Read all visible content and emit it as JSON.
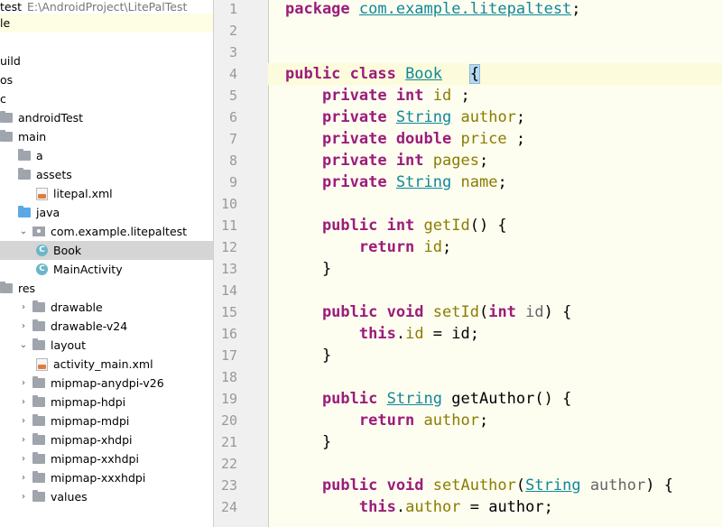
{
  "project_tree": {
    "root_label_partial": "test",
    "root_path": "E:\\AndroidProject\\LitePalTest",
    "items": [
      {
        "label": "le",
        "depth": 0,
        "chevron": "",
        "icon": "none",
        "state": "hl"
      },
      {
        "label": "",
        "depth": 0,
        "chevron": "",
        "icon": "none",
        "state": ""
      },
      {
        "label": "uild",
        "depth": 0,
        "chevron": "",
        "icon": "none",
        "state": ""
      },
      {
        "label": "os",
        "depth": 0,
        "chevron": "",
        "icon": "none",
        "state": ""
      },
      {
        "label": "c",
        "depth": 0,
        "chevron": "",
        "icon": "none",
        "state": ""
      },
      {
        "label": "androidTest",
        "depth": 0,
        "chevron": "",
        "icon": "folder",
        "state": ""
      },
      {
        "label": "main",
        "depth": 0,
        "chevron": "",
        "icon": "folder",
        "state": ""
      },
      {
        "label": "a",
        "depth": 1,
        "chevron": "",
        "icon": "folder",
        "state": ""
      },
      {
        "label": "assets",
        "depth": 1,
        "chevron": "",
        "icon": "folder",
        "state": ""
      },
      {
        "label": "litepal.xml",
        "depth": 2,
        "chevron": "",
        "icon": "xml",
        "state": ""
      },
      {
        "label": "java",
        "depth": 1,
        "chevron": "",
        "icon": "folder-blue",
        "state": ""
      },
      {
        "label": "com.example.litepaltest",
        "depth": 1,
        "chevron": "⌄",
        "icon": "package",
        "state": ""
      },
      {
        "label": "Book",
        "depth": 2,
        "chevron": "",
        "icon": "class",
        "state": "selected"
      },
      {
        "label": "MainActivity",
        "depth": 2,
        "chevron": "",
        "icon": "class",
        "state": ""
      },
      {
        "label": "res",
        "depth": 0,
        "chevron": "",
        "icon": "folder",
        "state": ""
      },
      {
        "label": "drawable",
        "depth": 1,
        "chevron": "›",
        "icon": "folder",
        "state": ""
      },
      {
        "label": "drawable-v24",
        "depth": 1,
        "chevron": "›",
        "icon": "folder",
        "state": ""
      },
      {
        "label": "layout",
        "depth": 1,
        "chevron": "⌄",
        "icon": "folder",
        "state": ""
      },
      {
        "label": "activity_main.xml",
        "depth": 2,
        "chevron": "",
        "icon": "xml",
        "state": ""
      },
      {
        "label": "mipmap-anydpi-v26",
        "depth": 1,
        "chevron": "›",
        "icon": "folder",
        "state": ""
      },
      {
        "label": "mipmap-hdpi",
        "depth": 1,
        "chevron": "›",
        "icon": "folder",
        "state": ""
      },
      {
        "label": "mipmap-mdpi",
        "depth": 1,
        "chevron": "›",
        "icon": "folder",
        "state": ""
      },
      {
        "label": "mipmap-xhdpi",
        "depth": 1,
        "chevron": "›",
        "icon": "folder",
        "state": ""
      },
      {
        "label": "mipmap-xxhdpi",
        "depth": 1,
        "chevron": "›",
        "icon": "folder",
        "state": ""
      },
      {
        "label": "mipmap-xxxhdpi",
        "depth": 1,
        "chevron": "›",
        "icon": "folder",
        "state": ""
      },
      {
        "label": "values",
        "depth": 1,
        "chevron": "›",
        "icon": "folder",
        "state": ""
      }
    ]
  },
  "editor": {
    "colors": {
      "keyword": "#9b1c7b",
      "type": "#10889a",
      "field": "#8a7d00",
      "param": "#666666"
    },
    "lines": [
      {
        "n": "1",
        "tokens": [
          {
            "t": "package ",
            "c": "kw"
          },
          {
            "t": "com.example.litepaltest",
            "c": "ref"
          },
          {
            "t": ";",
            "c": ""
          }
        ],
        "fold": false
      },
      {
        "n": "2",
        "tokens": [],
        "fold": false
      },
      {
        "n": "3",
        "tokens": [],
        "fold": false
      },
      {
        "n": "4",
        "tokens": [
          {
            "t": "public class ",
            "c": "kw"
          },
          {
            "t": "Book",
            "c": "ty"
          },
          {
            "t": "   ",
            "c": ""
          },
          {
            "t": "{",
            "c": "brace-hl"
          }
        ],
        "fold": false
      },
      {
        "n": "5",
        "tokens": [
          {
            "t": "    private int ",
            "c": "kw"
          },
          {
            "t": "id",
            "c": "fld"
          },
          {
            "t": " ;",
            "c": ""
          }
        ],
        "fold": false
      },
      {
        "n": "6",
        "tokens": [
          {
            "t": "    private ",
            "c": "kw"
          },
          {
            "t": "String",
            "c": "ty"
          },
          {
            "t": " ",
            "c": ""
          },
          {
            "t": "author",
            "c": "fld"
          },
          {
            "t": ";",
            "c": ""
          }
        ],
        "fold": false
      },
      {
        "n": "7",
        "tokens": [
          {
            "t": "    private double ",
            "c": "kw"
          },
          {
            "t": "price",
            "c": "fld"
          },
          {
            "t": " ;",
            "c": ""
          }
        ],
        "fold": false
      },
      {
        "n": "8",
        "tokens": [
          {
            "t": "    private int ",
            "c": "kw"
          },
          {
            "t": "pages",
            "c": "fld"
          },
          {
            "t": ";",
            "c": ""
          }
        ],
        "fold": false
      },
      {
        "n": "9",
        "tokens": [
          {
            "t": "    private ",
            "c": "kw"
          },
          {
            "t": "String",
            "c": "ty"
          },
          {
            "t": " ",
            "c": ""
          },
          {
            "t": "name",
            "c": "fld"
          },
          {
            "t": ";",
            "c": ""
          }
        ],
        "fold": false
      },
      {
        "n": "10",
        "tokens": [],
        "fold": false
      },
      {
        "n": "11",
        "tokens": [
          {
            "t": "    public int ",
            "c": "kw"
          },
          {
            "t": "getId",
            "c": "fld"
          },
          {
            "t": "() {",
            "c": ""
          }
        ],
        "fold": true
      },
      {
        "n": "12",
        "tokens": [
          {
            "t": "        return ",
            "c": "kw"
          },
          {
            "t": "id",
            "c": "fld"
          },
          {
            "t": ";",
            "c": ""
          }
        ],
        "fold": false
      },
      {
        "n": "13",
        "tokens": [
          {
            "t": "    }",
            "c": ""
          }
        ],
        "fold": true
      },
      {
        "n": "14",
        "tokens": [],
        "fold": false
      },
      {
        "n": "15",
        "tokens": [
          {
            "t": "    public void ",
            "c": "kw"
          },
          {
            "t": "setId",
            "c": "fld"
          },
          {
            "t": "(",
            "c": ""
          },
          {
            "t": "int ",
            "c": "kw"
          },
          {
            "t": "id",
            "c": "par"
          },
          {
            "t": ") {",
            "c": ""
          }
        ],
        "fold": true
      },
      {
        "n": "16",
        "tokens": [
          {
            "t": "        this",
            "c": "kw"
          },
          {
            "t": ".",
            "c": ""
          },
          {
            "t": "id",
            "c": "fld"
          },
          {
            "t": " = id;",
            "c": ""
          }
        ],
        "fold": false
      },
      {
        "n": "17",
        "tokens": [
          {
            "t": "    }",
            "c": ""
          }
        ],
        "fold": true
      },
      {
        "n": "18",
        "tokens": [],
        "fold": false
      },
      {
        "n": "19",
        "tokens": [
          {
            "t": "    public ",
            "c": "kw"
          },
          {
            "t": "String",
            "c": "ty"
          },
          {
            "t": " getAuthor() {",
            "c": ""
          }
        ],
        "fold": true
      },
      {
        "n": "20",
        "tokens": [
          {
            "t": "        return ",
            "c": "kw"
          },
          {
            "t": "author",
            "c": "fld"
          },
          {
            "t": ";",
            "c": ""
          }
        ],
        "fold": false
      },
      {
        "n": "21",
        "tokens": [
          {
            "t": "    }",
            "c": ""
          }
        ],
        "fold": true
      },
      {
        "n": "22",
        "tokens": [],
        "fold": false
      },
      {
        "n": "23",
        "tokens": [
          {
            "t": "    public void ",
            "c": "kw"
          },
          {
            "t": "setAuthor",
            "c": "fld"
          },
          {
            "t": "(",
            "c": ""
          },
          {
            "t": "String",
            "c": "ty"
          },
          {
            "t": " ",
            "c": ""
          },
          {
            "t": "author",
            "c": "par"
          },
          {
            "t": ") {",
            "c": ""
          }
        ],
        "fold": true
      },
      {
        "n": "24",
        "tokens": [
          {
            "t": "        this",
            "c": "kw"
          },
          {
            "t": ".",
            "c": ""
          },
          {
            "t": "author",
            "c": "fld"
          },
          {
            "t": " = author;",
            "c": ""
          }
        ],
        "fold": false
      }
    ]
  }
}
